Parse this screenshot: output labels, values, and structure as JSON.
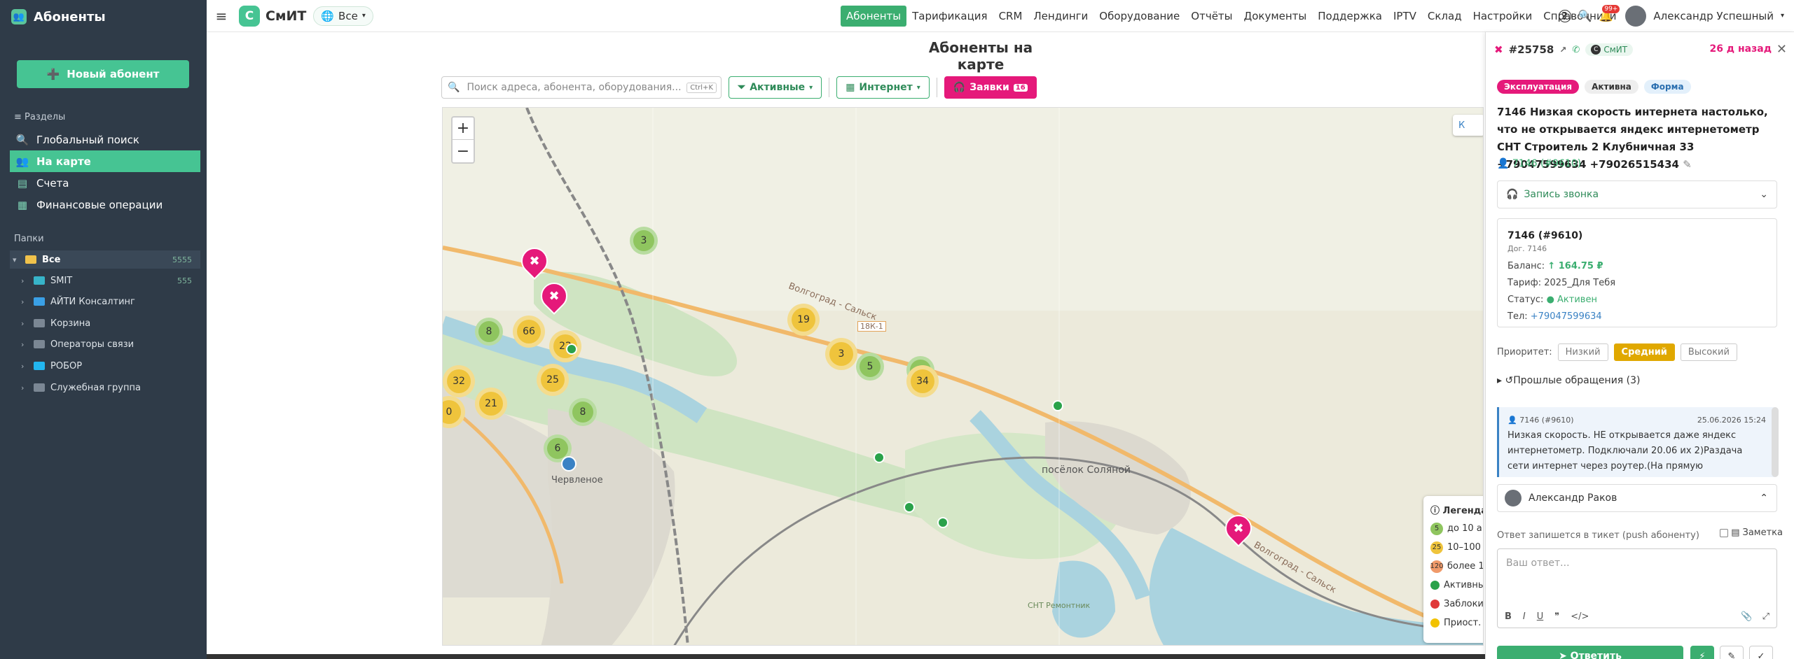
{
  "sidebar": {
    "title": "Абоненты",
    "new_button": "Новый абонент",
    "sections_label": "Разделы",
    "items": [
      {
        "label": "Глобальный поиск"
      },
      {
        "label": "На карте"
      },
      {
        "label": "Счета"
      },
      {
        "label": "Финансовые операции"
      }
    ],
    "folders_label": "Папки",
    "folders": [
      {
        "label": "Все",
        "count": "5555"
      },
      {
        "label": "SMIT",
        "count": "555"
      },
      {
        "label": "АЙТИ Консалтинг",
        "count": ""
      },
      {
        "label": "Корзина",
        "count": ""
      },
      {
        "label": "Операторы связи",
        "count": ""
      },
      {
        "label": "РОБОР",
        "count": ""
      },
      {
        "label": "Служебная группа",
        "count": ""
      }
    ]
  },
  "topbar": {
    "brand": "СмИТ",
    "logo_letter": "C",
    "scope": "Все",
    "nav": [
      "Абоненты",
      "Тарификация",
      "CRM",
      "Лендинги",
      "Оборудование",
      "Отчёты",
      "Документы",
      "Поддержка",
      "IPTV",
      "Склад",
      "Настройки",
      "Справочники"
    ],
    "active_nav": "Абоненты",
    "notif_badge": "99+",
    "user": "Александр Успешный"
  },
  "main": {
    "title": "Абоненты на карте",
    "search_placeholder": "Поиск адреса, абонента, оборудования...",
    "shortcut": "Ctrl+K",
    "filter_active": "Активные",
    "filter_service": "Интернет",
    "requests_label": "Заявки",
    "requests_count": "16"
  },
  "map": {
    "road_labels": [
      "Волгоград - Сальск",
      "18К-1",
      "Волгоград - Сальск"
    ],
    "places": [
      "посёлок Соляной",
      "Червленое",
      "СНТ Ремонтник"
    ],
    "clusters": [
      {
        "n": "3",
        "c": "g"
      },
      {
        "n": "8",
        "c": "g"
      },
      {
        "n": "66",
        "c": "y"
      },
      {
        "n": "22",
        "c": "y"
      },
      {
        "n": "25",
        "c": "y"
      },
      {
        "n": "8",
        "c": "g"
      },
      {
        "n": "21",
        "c": "y"
      },
      {
        "n": "6",
        "c": "g"
      },
      {
        "n": "32",
        "c": "y"
      },
      {
        "n": "19",
        "c": "y"
      },
      {
        "n": "3",
        "c": "y"
      },
      {
        "n": "5",
        "c": "g"
      },
      {
        "n": "2",
        "c": "g"
      },
      {
        "n": "34",
        "c": "y"
      },
      {
        "n": "0",
        "c": "y"
      }
    ],
    "legend": {
      "title": "Легенда",
      "rows": [
        {
          "n": "5",
          "label": "до 10 а"
        },
        {
          "n": "25",
          "label": "10–100"
        },
        {
          "n": "120",
          "label": "более 1"
        },
        {
          "color": "#2aa24a",
          "label": "Активный"
        },
        {
          "color": "#e03a3a",
          "label": "Заблокир"
        },
        {
          "color": "#f2c200",
          "label": "Приост."
        }
      ]
    },
    "corner_button": "К"
  },
  "panel": {
    "ticket_id": "#25758",
    "channel": "СмИТ",
    "ago": "26 д назад",
    "tags": [
      {
        "label": "Эксплуатация",
        "bg": "#e5197a",
        "fg": "#fff"
      },
      {
        "label": "Активна",
        "bg": "#eee",
        "fg": "#333"
      },
      {
        "label": "Форма",
        "bg": "#e3f0fb",
        "fg": "#2a6fb0"
      }
    ],
    "title": "7146 Низкая скорость интернета настолько, что не открывается яндекс интернетометр СНТ Строитель 2 Клубничная 33 +79047599634 +79026515434",
    "subscriber_link": "7146 (#9610)",
    "call_record": "Запись звонка",
    "account": {
      "name": "7146 (#9610)",
      "contract": "Дог. 7146",
      "balance_label": "Баланс:",
      "balance": "↑ 164.75 ₽",
      "tariff_label": "Тариф:",
      "tariff": "2025_Для Тебя",
      "status_label": "Статус:",
      "status": "● Активен",
      "phone_label": "Тел:",
      "phone": "+79047599634"
    },
    "priority_label": "Приоритет:",
    "priorities": [
      "Низкий",
      "Средний",
      "Высокий"
    ],
    "priority_selected": "Средний",
    "past": "Прошлые обращения (3)",
    "message": {
      "author": "7146 (#9610)",
      "date": "25.06.2026 15:24",
      "text": "Низкая скорость. НЕ открывается даже яндекс интернетометр. Подключали 20.06 их 2)Раздача сети интернет через роутер.(На прямую"
    },
    "assignee": "Александр Раков",
    "note_hint": "Ответ запишется в тикет (push абоненту)",
    "zametka": "Заметка",
    "reply_placeholder": "Ваш ответ...",
    "send_label": "Ответить"
  }
}
